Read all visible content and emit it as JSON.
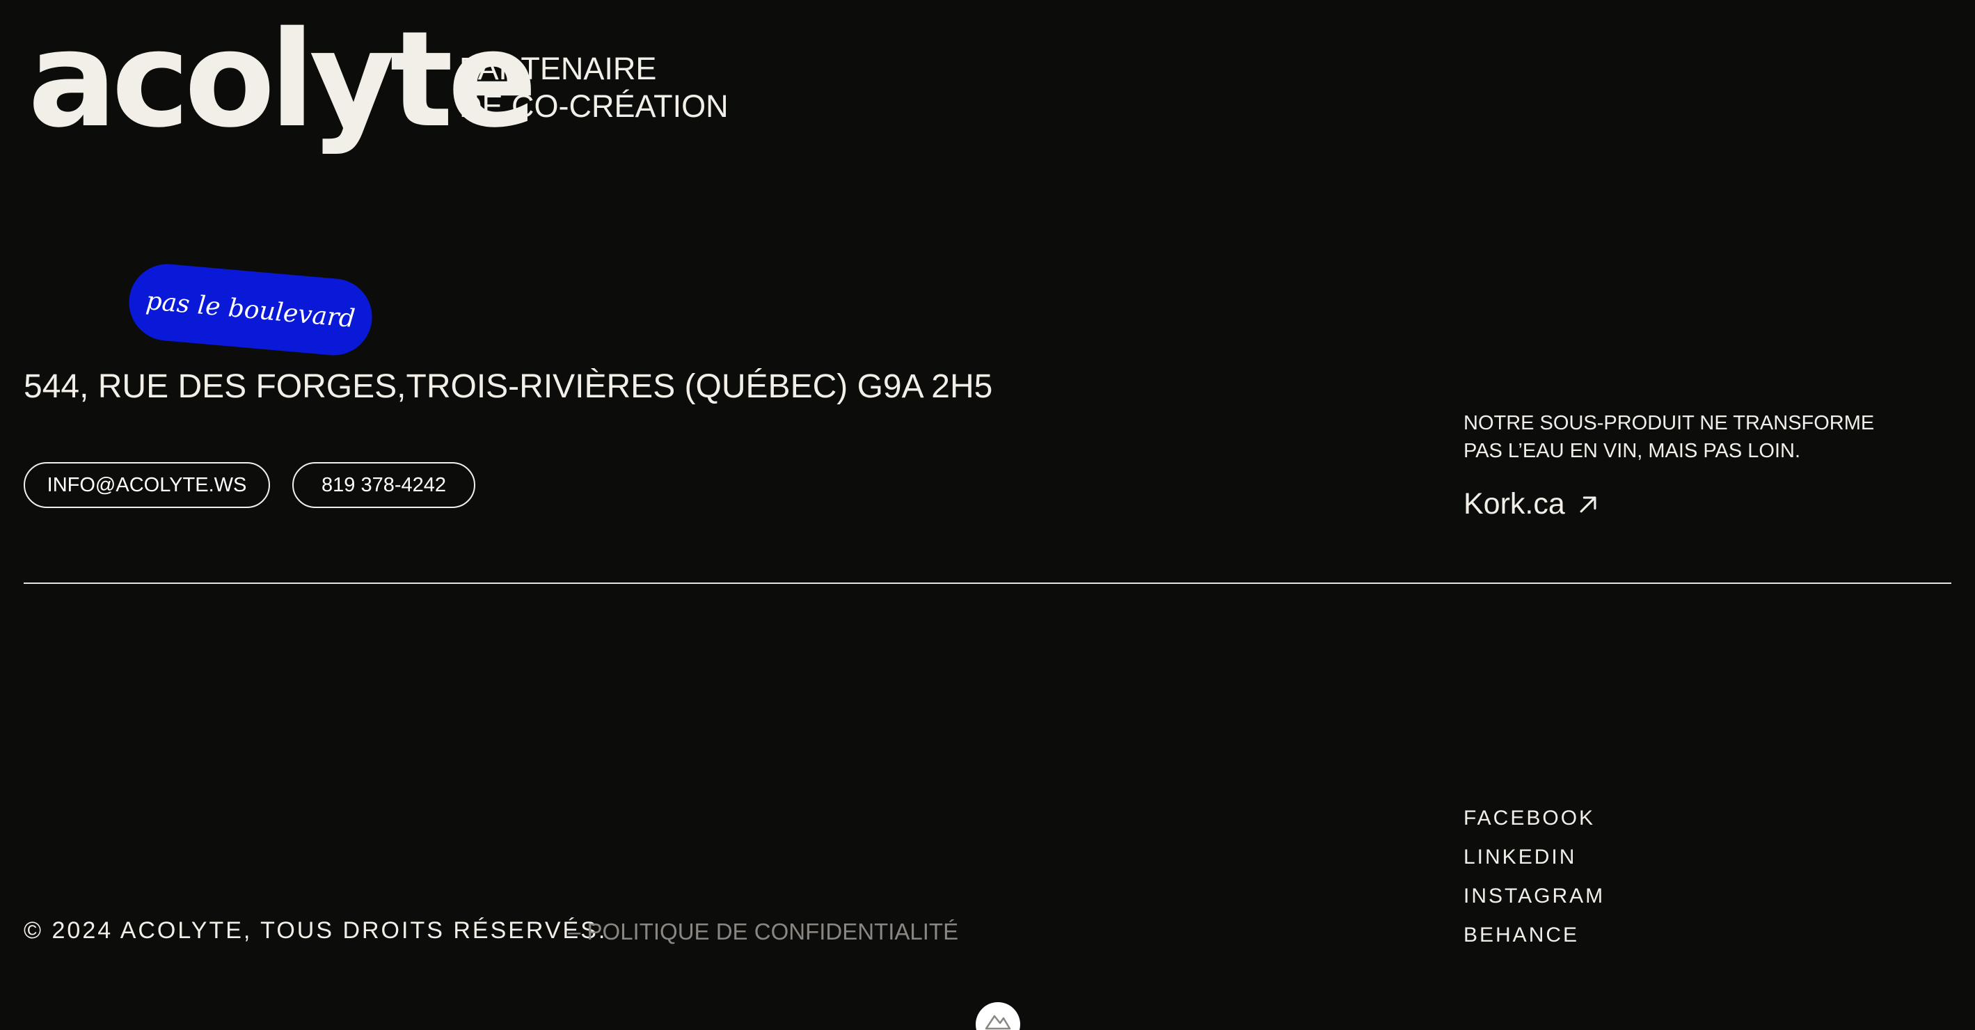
{
  "header": {
    "logo_text": "acolyte",
    "tagline_line1": "PARTENAIRE",
    "tagline_line2": "DE CO-CRÉATION"
  },
  "sticker": {
    "text": "pas le boulevard",
    "color": "#0a19d8"
  },
  "contact": {
    "address": "544, RUE DES FORGES,TROIS-RIVIÈRES (QUÉBEC) G9A 2H5",
    "email_label": "INFO@ACOLYTE.WS",
    "phone_label": "819 378-4242"
  },
  "promo": {
    "text": "NOTRE SOUS-PRODUIT NE TRANSFORME PAS L’EAU EN VIN, MAIS PAS LOIN.",
    "link_label": "Kork.ca",
    "link_icon": "arrow-up-right-icon"
  },
  "social": {
    "items": [
      {
        "label": "FACEBOOK"
      },
      {
        "label": "LINKEDIN"
      },
      {
        "label": "INSTAGRAM"
      },
      {
        "label": "BEHANCE"
      }
    ]
  },
  "footer": {
    "copyright": "© 2024 ACOLYTE, TOUS DROITS RÉSERVÉS.",
    "privacy_label": "– POLITIQUE DE CONFIDENTIALITÉ"
  },
  "badge": {
    "icon": "mountain-logo-icon"
  },
  "colors": {
    "background": "#0c0c0b",
    "text": "#f2efe8",
    "accent": "#0a19d8",
    "muted": "#8a8782"
  }
}
